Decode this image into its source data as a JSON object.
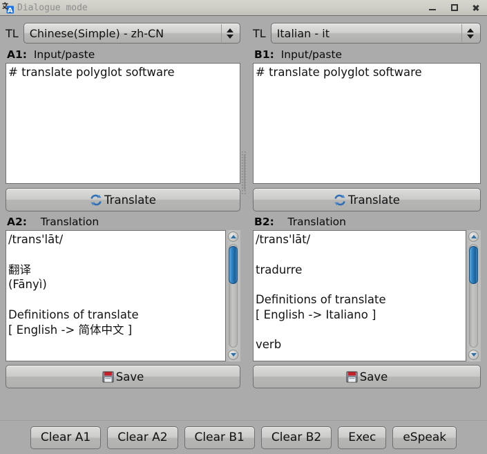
{
  "window": {
    "title": "Dialogue mode",
    "icon": "translate-app-icon",
    "controls": {
      "minimize": "minimize",
      "maximize": "maximize",
      "close": "close"
    },
    "background_color": "#ababab",
    "titlebar_color": "#cdcdc5"
  },
  "left_pane": {
    "tl_label": "TL",
    "language": "Chinese(Simple) - zh-CN",
    "input_label_id": "A1:",
    "input_label_text": "Input/paste",
    "input_value": "# translate polyglot software",
    "translate_button": "Translate",
    "translate_icon": "refresh-sync-icon",
    "translation_label_id": "A2:",
    "translation_label_text": "Translation",
    "translation_value": "/trans'lāt/\n\n翻译\n(Fānyì)\n\nDefinitions of translate\n[ English -> 简体中文 ]",
    "save_button": "Save",
    "save_icon": "floppy-disk-icon"
  },
  "right_pane": {
    "tl_label": "TL",
    "language": "Italian - it",
    "input_label_id": "B1:",
    "input_label_text": "Input/paste",
    "input_value": "# translate polyglot software",
    "translate_button": "Translate",
    "translate_icon": "refresh-sync-icon",
    "translation_label_id": "B2:",
    "translation_label_text": "Translation",
    "translation_value": "/trans'lāt/\n\ntradurre\n\nDefinitions of translate\n[ English -> Italiano ]\n\nverb",
    "save_button": "Save",
    "save_icon": "floppy-disk-icon"
  },
  "bottom_bar": {
    "buttons": [
      {
        "label": "Clear A1"
      },
      {
        "label": "Clear A2"
      },
      {
        "label": "Clear B1"
      },
      {
        "label": "Clear B2"
      },
      {
        "label": "Exec"
      },
      {
        "label": "eSpeak"
      }
    ]
  },
  "accent_colors": {
    "scrollbar_thumb": "#2f82c4",
    "translate_icon": "#2f6fb5",
    "save_icon_top": "#c8202a"
  }
}
